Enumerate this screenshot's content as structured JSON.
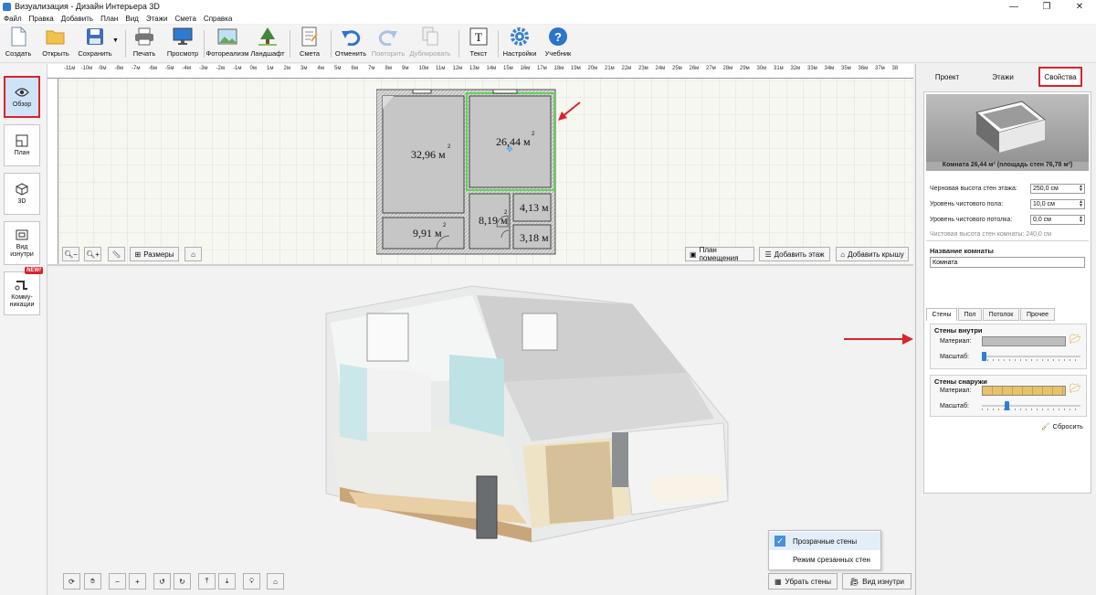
{
  "window": {
    "title": "Визуализация - Дизайн Интерьера 3D",
    "controls": [
      "—",
      "❐",
      "✕"
    ]
  },
  "menu": [
    "Файл",
    "Правка",
    "Добавить",
    "План",
    "Вид",
    "Этажи",
    "Смета",
    "Справка"
  ],
  "toolbar": {
    "create": "Создать",
    "open": "Открыть",
    "save": "Сохранить",
    "print": "Печать",
    "preview": "Просмотр",
    "photo": "Фотореализм",
    "landscape": "Ландшафт",
    "estimate": "Смета",
    "undo": "Отменить",
    "redo": "Повторить",
    "duplicate": "Дублировать",
    "text": "Текст",
    "settings": "Настройки",
    "tutorial": "Учебник"
  },
  "leftbar": {
    "overview": "Обзор",
    "plan": "План",
    "view3d": "3D",
    "inside": "Вид изнутри",
    "comms": "Комму-никации",
    "new_badge": "NEW!"
  },
  "ruler": {
    "zero": "0м",
    "marks": [
      "-11м",
      "-10м",
      "-9м",
      "-8м",
      "-7м",
      "-6м",
      "-5м",
      "-4м",
      "-3м",
      "-2м",
      "-1м",
      "1м",
      "2м",
      "3м",
      "4м",
      "5м",
      "6м",
      "7м",
      "8м",
      "9м",
      "10м",
      "11м",
      "12м",
      "13м",
      "14м",
      "15м",
      "16м",
      "17м",
      "18м",
      "19м",
      "20м",
      "21м",
      "22м",
      "23м",
      "24м",
      "25м",
      "26м",
      "27м",
      "28м",
      "29м",
      "30м",
      "31м",
      "32м",
      "33м",
      "34м",
      "35м",
      "36м",
      "37м",
      "38"
    ]
  },
  "plan": {
    "rooms": [
      {
        "area": "32,96 м",
        "unit": "2"
      },
      {
        "area": "26,44 м",
        "unit": "2"
      },
      {
        "area": "9,91 м",
        "unit": "2"
      },
      {
        "area": "8,19 м",
        "unit": "2"
      },
      {
        "area": "4,13 м",
        "unit": "2"
      },
      {
        "area": "3,18 м",
        "unit": "2"
      }
    ],
    "sizes_btn": "Размеры",
    "room_plan": "План помещения",
    "add_floor": "Добавить этаж",
    "add_roof": "Добавить крышу"
  },
  "view3d": {
    "transparent_walls": "Прозрачные стены",
    "cut_walls": "Режим срезанных стен",
    "hide_walls": "Убрать стены",
    "inside_view": "Вид изнутри"
  },
  "right": {
    "tabs": [
      "Проект",
      "Этажи",
      "Свойства"
    ],
    "caption": "Комната 26,44 м² (площадь стен 76,78 м²)",
    "rough_height_label": "Черновая высота стен этажа:",
    "rough_height": "250,0 см",
    "floor_level_label": "Уровень чистового пола:",
    "floor_level": "10,0 см",
    "ceiling_level_label": "Уровень чистового потолка:",
    "ceiling_level": "0,0 см",
    "clean_height": "Чистовая высота стен комнаты: 240,0 см",
    "room_name_label": "Название комнаты",
    "room_name": "Комната",
    "subtabs": [
      "Стены",
      "Пол",
      "Потолок",
      "Прочее"
    ],
    "walls_inside": "Стены внутри",
    "walls_outside": "Стены снаружи",
    "material": "Материал:",
    "scale": "Масштаб:",
    "reset": "Сбросить"
  },
  "colors": {
    "accent": "#d9232d",
    "select": "#4b8edc"
  }
}
